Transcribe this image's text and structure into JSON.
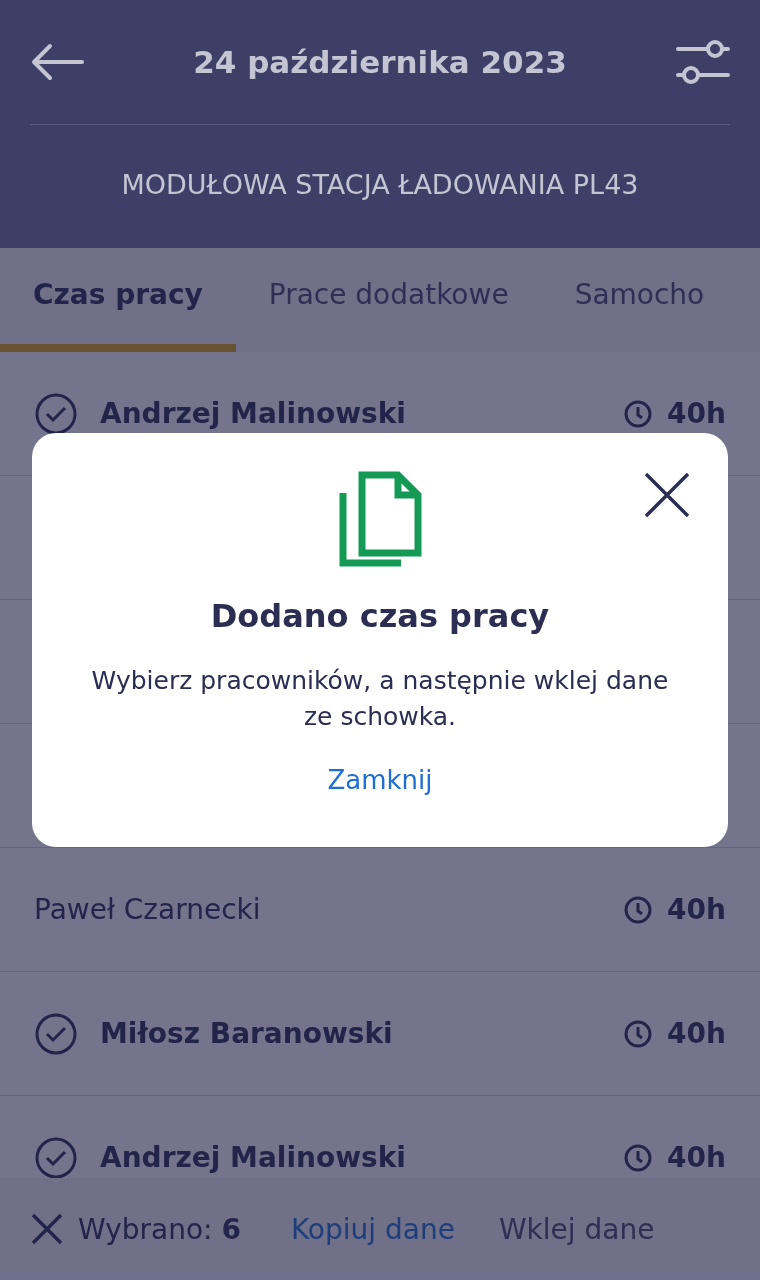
{
  "header": {
    "title": "24 października 2023",
    "subtitle": "MODUŁOWA STACJA ŁADOWANIA PL43"
  },
  "tabs": [
    {
      "label": "Czas pracy",
      "selected": true
    },
    {
      "label": "Prace dodatkowe",
      "selected": false
    },
    {
      "label": "Samocho",
      "selected": false
    }
  ],
  "rows": [
    {
      "name": "Andrzej Malinowski",
      "checked": true,
      "hours": "40h"
    },
    {
      "name": "Paweł Czarnecki",
      "checked": false,
      "hours": "40h"
    },
    {
      "name": "Miłosz Baranowski",
      "checked": true,
      "hours": "40h"
    },
    {
      "name": "Andrzej Malinowski",
      "checked": true,
      "hours": "40h"
    }
  ],
  "bottom_bar": {
    "selected_count": "Wybrano: **6**",
    "copy": "Kopiuj dane",
    "paste": "Wklej dane"
  },
  "dialog": {
    "title": "Dodano czas pracy",
    "message": "Wybierz pracowników, a następnie wklej dane ze schowka.",
    "close": "Zamknij"
  }
}
